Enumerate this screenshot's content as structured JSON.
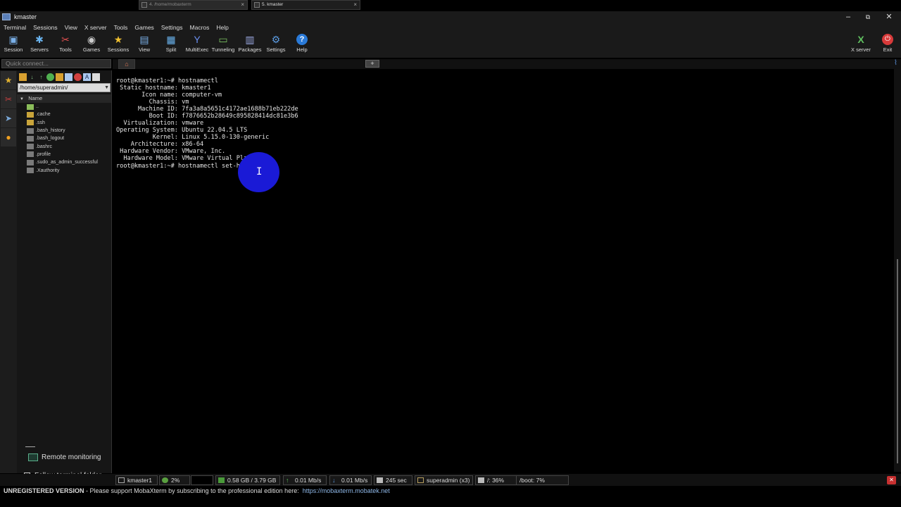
{
  "window": {
    "title": "kmaster",
    "minimize": "–",
    "restore": "⧉",
    "close": "✕"
  },
  "menu": [
    "Terminal",
    "Sessions",
    "View",
    "X server",
    "Tools",
    "Games",
    "Settings",
    "Macros",
    "Help"
  ],
  "toolbar": {
    "buttons": [
      {
        "label": "Session",
        "icon": "session-icon"
      },
      {
        "label": "Servers",
        "icon": "servers-icon"
      },
      {
        "label": "Tools",
        "icon": "tools-icon"
      },
      {
        "label": "Games",
        "icon": "gamepad-icon"
      },
      {
        "label": "Sessions",
        "icon": "star-icon"
      },
      {
        "label": "View",
        "icon": "view-icon"
      },
      {
        "label": "Split",
        "icon": "split-icon"
      },
      {
        "label": "MultiExec",
        "icon": "fork-icon"
      },
      {
        "label": "Tunneling",
        "icon": "tunnel-icon"
      },
      {
        "label": "Packages",
        "icon": "packages-icon"
      },
      {
        "label": "Settings",
        "icon": "gear-icon"
      },
      {
        "label": "Help",
        "icon": "help-icon"
      }
    ],
    "xserver_label": "X server",
    "exit_label": "Exit"
  },
  "quick_connect_placeholder": "Quick connect...",
  "tabs": [
    {
      "label": "4. /home/mobaxterm",
      "active": false
    },
    {
      "label": "5. kmaster",
      "active": true
    }
  ],
  "file_browser": {
    "path": "/home/superadmin/",
    "column_header": "Name",
    "items": [
      {
        "name": "..",
        "type": "up"
      },
      {
        "name": ".cache",
        "type": "folder"
      },
      {
        "name": ".ssh",
        "type": "folder"
      },
      {
        "name": ".bash_history",
        "type": "doc"
      },
      {
        "name": ".bash_logout",
        "type": "doc"
      },
      {
        "name": ".bashrc",
        "type": "doc"
      },
      {
        "name": ".profile",
        "type": "doc"
      },
      {
        "name": ".sudo_as_admin_successful",
        "type": "doc"
      },
      {
        "name": ".Xauthority",
        "type": "doc"
      }
    ],
    "remote_monitoring": "Remote monitoring",
    "follow_terminal_folder": "Follow terminal folder"
  },
  "terminal": {
    "lines": [
      "root@kmaster1:~# hostnamectl",
      " Static hostname: kmaster1",
      "       Icon name: computer-vm",
      "         Chassis: vm",
      "      Machine ID: 7fa3a8a5651c4172ae1688b71eb222de",
      "         Boot ID: f7876652b28649c895828414dc81e3b6",
      "  Virtualization: vmware",
      "Operating System: Ubuntu 22.04.5 LTS",
      "          Kernel: Linux 5.15.0-130-generic",
      "    Architecture: x86-64",
      " Hardware Vendor: VMware, Inc.",
      "  Hardware Model: VMware Virtual Platform"
    ],
    "prompt_line": "root@kmaster1:~# hostnamectl set-host"
  },
  "status": {
    "host": "kmaster1",
    "cpu": "2%",
    "memory": "0.58 GB / 3.79 GB",
    "upload": "0.01 Mb/s",
    "download": "0.01 Mb/s",
    "uptime": "245 sec",
    "users": "superadmin (x3)",
    "disk_root": "/: 36%",
    "disk_boot": "/boot: 7%"
  },
  "footer": {
    "unregistered": "UNREGISTERED VERSION",
    "message": "  -  Please support MobaXterm by subscribing to the professional edition here:",
    "link": "https://mobaxterm.mobatek.net"
  }
}
